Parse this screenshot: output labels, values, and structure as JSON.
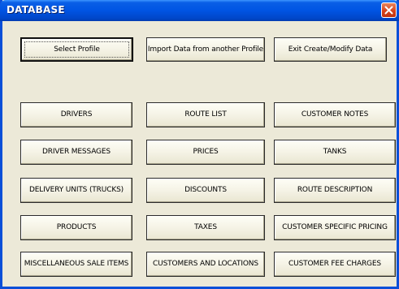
{
  "window": {
    "title": "DATABASE"
  },
  "top_buttons": [
    {
      "label": "Select Profile"
    },
    {
      "label": "Import Data from another Profile"
    },
    {
      "label": "Exit Create/Modify Data"
    }
  ],
  "grid_buttons": [
    {
      "label": "DRIVERS"
    },
    {
      "label": "ROUTE LIST"
    },
    {
      "label": "CUSTOMER NOTES"
    },
    {
      "label": "DRIVER MESSAGES"
    },
    {
      "label": "PRICES"
    },
    {
      "label": "TANKS"
    },
    {
      "label": "DELIVERY UNITS (TRUCKS)"
    },
    {
      "label": "DISCOUNTS"
    },
    {
      "label": "ROUTE DESCRIPTION"
    },
    {
      "label": "PRODUCTS"
    },
    {
      "label": "TAXES"
    },
    {
      "label": "CUSTOMER SPECIFIC PRICING"
    },
    {
      "label": "MISCELLANEOUS SALE ITEMS"
    },
    {
      "label": "CUSTOMERS AND LOCATIONS"
    },
    {
      "label": "CUSTOMER FEE CHARGES"
    }
  ]
}
